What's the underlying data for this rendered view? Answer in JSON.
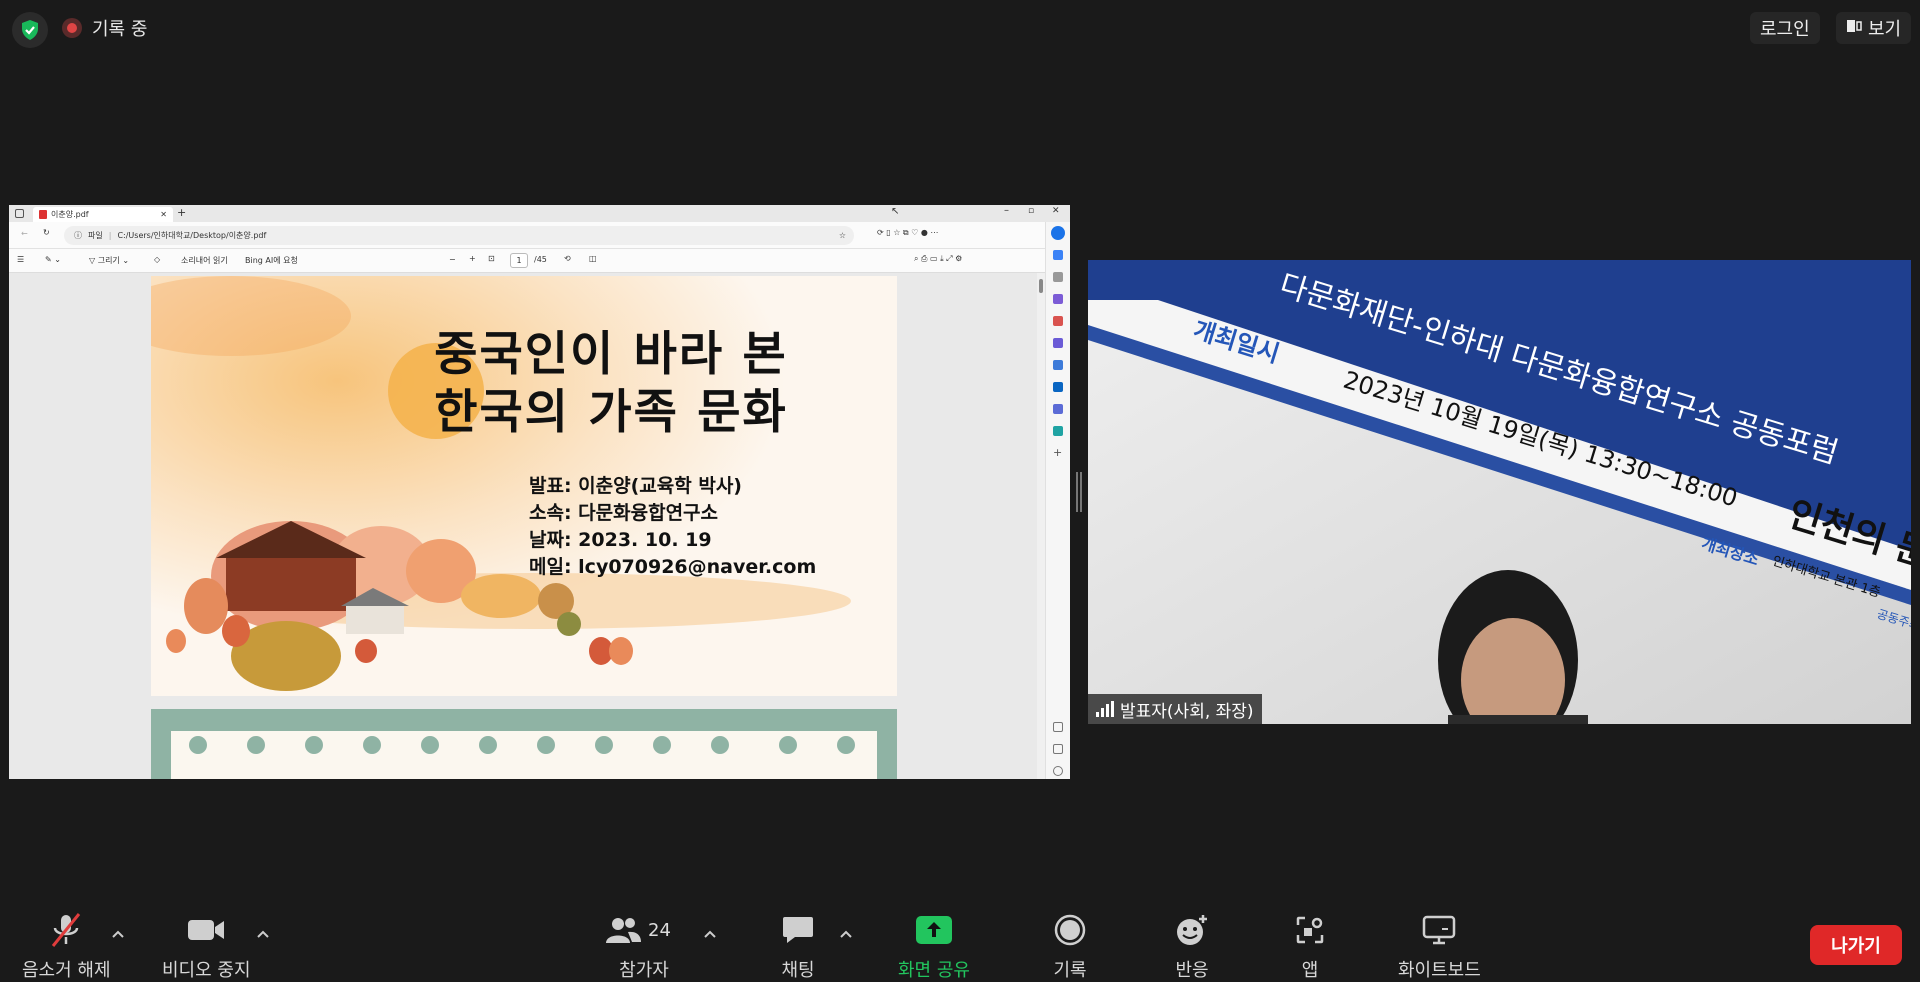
{
  "topbar": {
    "recording_label": "기록 중",
    "login_label": "로그인",
    "view_label": "보기"
  },
  "browser": {
    "tab_title": "이춘양.pdf",
    "address_prefix": "파일",
    "address_url": "C:/Users/인하대학교/Desktop/이춘양.pdf",
    "tool_draw": "그리기",
    "tool_read_aloud": "소리내어 읽기",
    "tool_bing": "Bing AI에 요청",
    "page_number": "1",
    "page_total": "/45"
  },
  "slide": {
    "title_line1": "중국인이 바라 본",
    "title_line2": "한국의 가족 문화",
    "presenter": "발표: 이춘양(교육학 박사)",
    "affiliation": "소속: 다문화융합연구소",
    "date": "날짜: 2023. 10. 19",
    "email": "메일: lcy070926@naver.com"
  },
  "video": {
    "banner_top": "다문화재단-인하대 다문화융합연구소 공동포럼",
    "banner_date_label": "개최일시",
    "banner_date": "2023년 10월 19일(목) 13:30~18:00",
    "banner_venue_label": "개최장소",
    "banner_venue": "인하대학교 본관 1층",
    "banner_big": "인천의 문",
    "banner_small": "공동주최",
    "participant_name": "발표자(사회, 좌장)"
  },
  "toolbar": {
    "unmute": "음소거 해제",
    "stop_video": "비디오 중지",
    "participants": "참가자",
    "participant_count": "24",
    "chat": "채팅",
    "share_screen": "화면 공유",
    "record": "기록",
    "reactions": "반응",
    "apps": "앱",
    "whiteboard": "화이트보드",
    "leave": "나가기"
  },
  "colors": {
    "share_green": "#22c55e",
    "leave_red": "#e02828",
    "shield_green": "#19b85a"
  }
}
